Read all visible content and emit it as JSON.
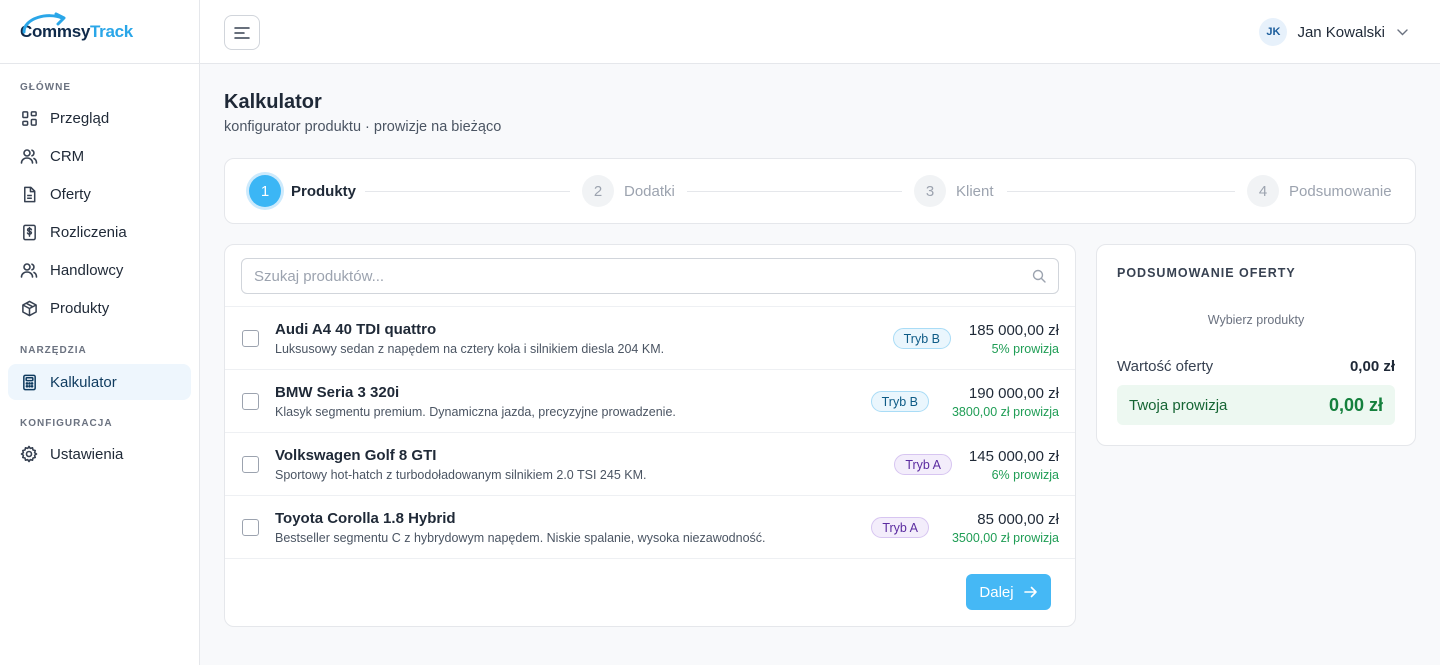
{
  "brand": {
    "part1": "Commsy",
    "part2": "Track"
  },
  "sidebar": {
    "sections": [
      {
        "label": "GŁÓWNE"
      },
      {
        "label": "NARZĘDZIA"
      },
      {
        "label": "KONFIGURACJA"
      }
    ],
    "items": [
      {
        "label": "Przegląd",
        "icon": "grid-icon"
      },
      {
        "label": "CRM",
        "icon": "users-icon"
      },
      {
        "label": "Oferty",
        "icon": "document-icon"
      },
      {
        "label": "Rozliczenia",
        "icon": "dollar-file-icon"
      },
      {
        "label": "Handlowcy",
        "icon": "users-icon"
      },
      {
        "label": "Produkty",
        "icon": "box-icon"
      },
      {
        "label": "Kalkulator",
        "icon": "calculator-icon",
        "active": true
      },
      {
        "label": "Ustawienia",
        "icon": "gear-icon"
      }
    ]
  },
  "topbar": {
    "user": {
      "initials": "JK",
      "name": "Jan Kowalski"
    }
  },
  "page": {
    "title": "Kalkulator",
    "subtitle": "konfigurator produktu · prowizje na bieżąco"
  },
  "stepper": {
    "steps": [
      {
        "num": "1",
        "label": "Produkty",
        "active": true
      },
      {
        "num": "2",
        "label": "Dodatki"
      },
      {
        "num": "3",
        "label": "Klient"
      },
      {
        "num": "4",
        "label": "Podsumowanie"
      }
    ]
  },
  "search": {
    "placeholder": "Szukaj produktów..."
  },
  "products": [
    {
      "name": "Audi A4 40 TDI quattro",
      "desc": "Luksusowy sedan z napędem na cztery koła i silnikiem diesla 204 KM.",
      "mode": "Tryb B",
      "price": "185 000,00 zł",
      "commission": "5% prowizja",
      "checked": false
    },
    {
      "name": "BMW Seria 3 320i",
      "desc": "Klasyk segmentu premium. Dynamiczna jazda, precyzyjne prowadzenie.",
      "mode": "Tryb B",
      "price": "190 000,00 zł",
      "commission": "3800,00 zł prowizja",
      "checked": false
    },
    {
      "name": "Volkswagen Golf 8 GTI",
      "desc": "Sportowy hot-hatch z turbodoładowanym silnikiem 2.0 TSI 245 KM.",
      "mode": "Tryb A",
      "price": "145 000,00 zł",
      "commission": "6% prowizja",
      "checked": false
    },
    {
      "name": "Toyota Corolla 1.8 Hybrid",
      "desc": "Bestseller segmentu C z hybrydowym napędem. Niskie spalanie, wysoka niezawodność.",
      "mode": "Tryb A",
      "price": "85 000,00 zł",
      "commission": "3500,00 zł prowizja",
      "checked": false
    }
  ],
  "next_button": {
    "label": "Dalej"
  },
  "summary": {
    "title": "PODSUMOWANIE OFERTY",
    "empty": "Wybierz produkty",
    "offer_value_label": "Wartość oferty",
    "offer_value": "0,00 zł",
    "commission_label": "Twoja prowizja",
    "commission_value": "0,00 zł"
  },
  "colors": {
    "accent": "#45b8f5",
    "brand_dark": "#0f2a4a",
    "brand_light": "#2aa6e8",
    "commission_green": "#1f9d55"
  }
}
